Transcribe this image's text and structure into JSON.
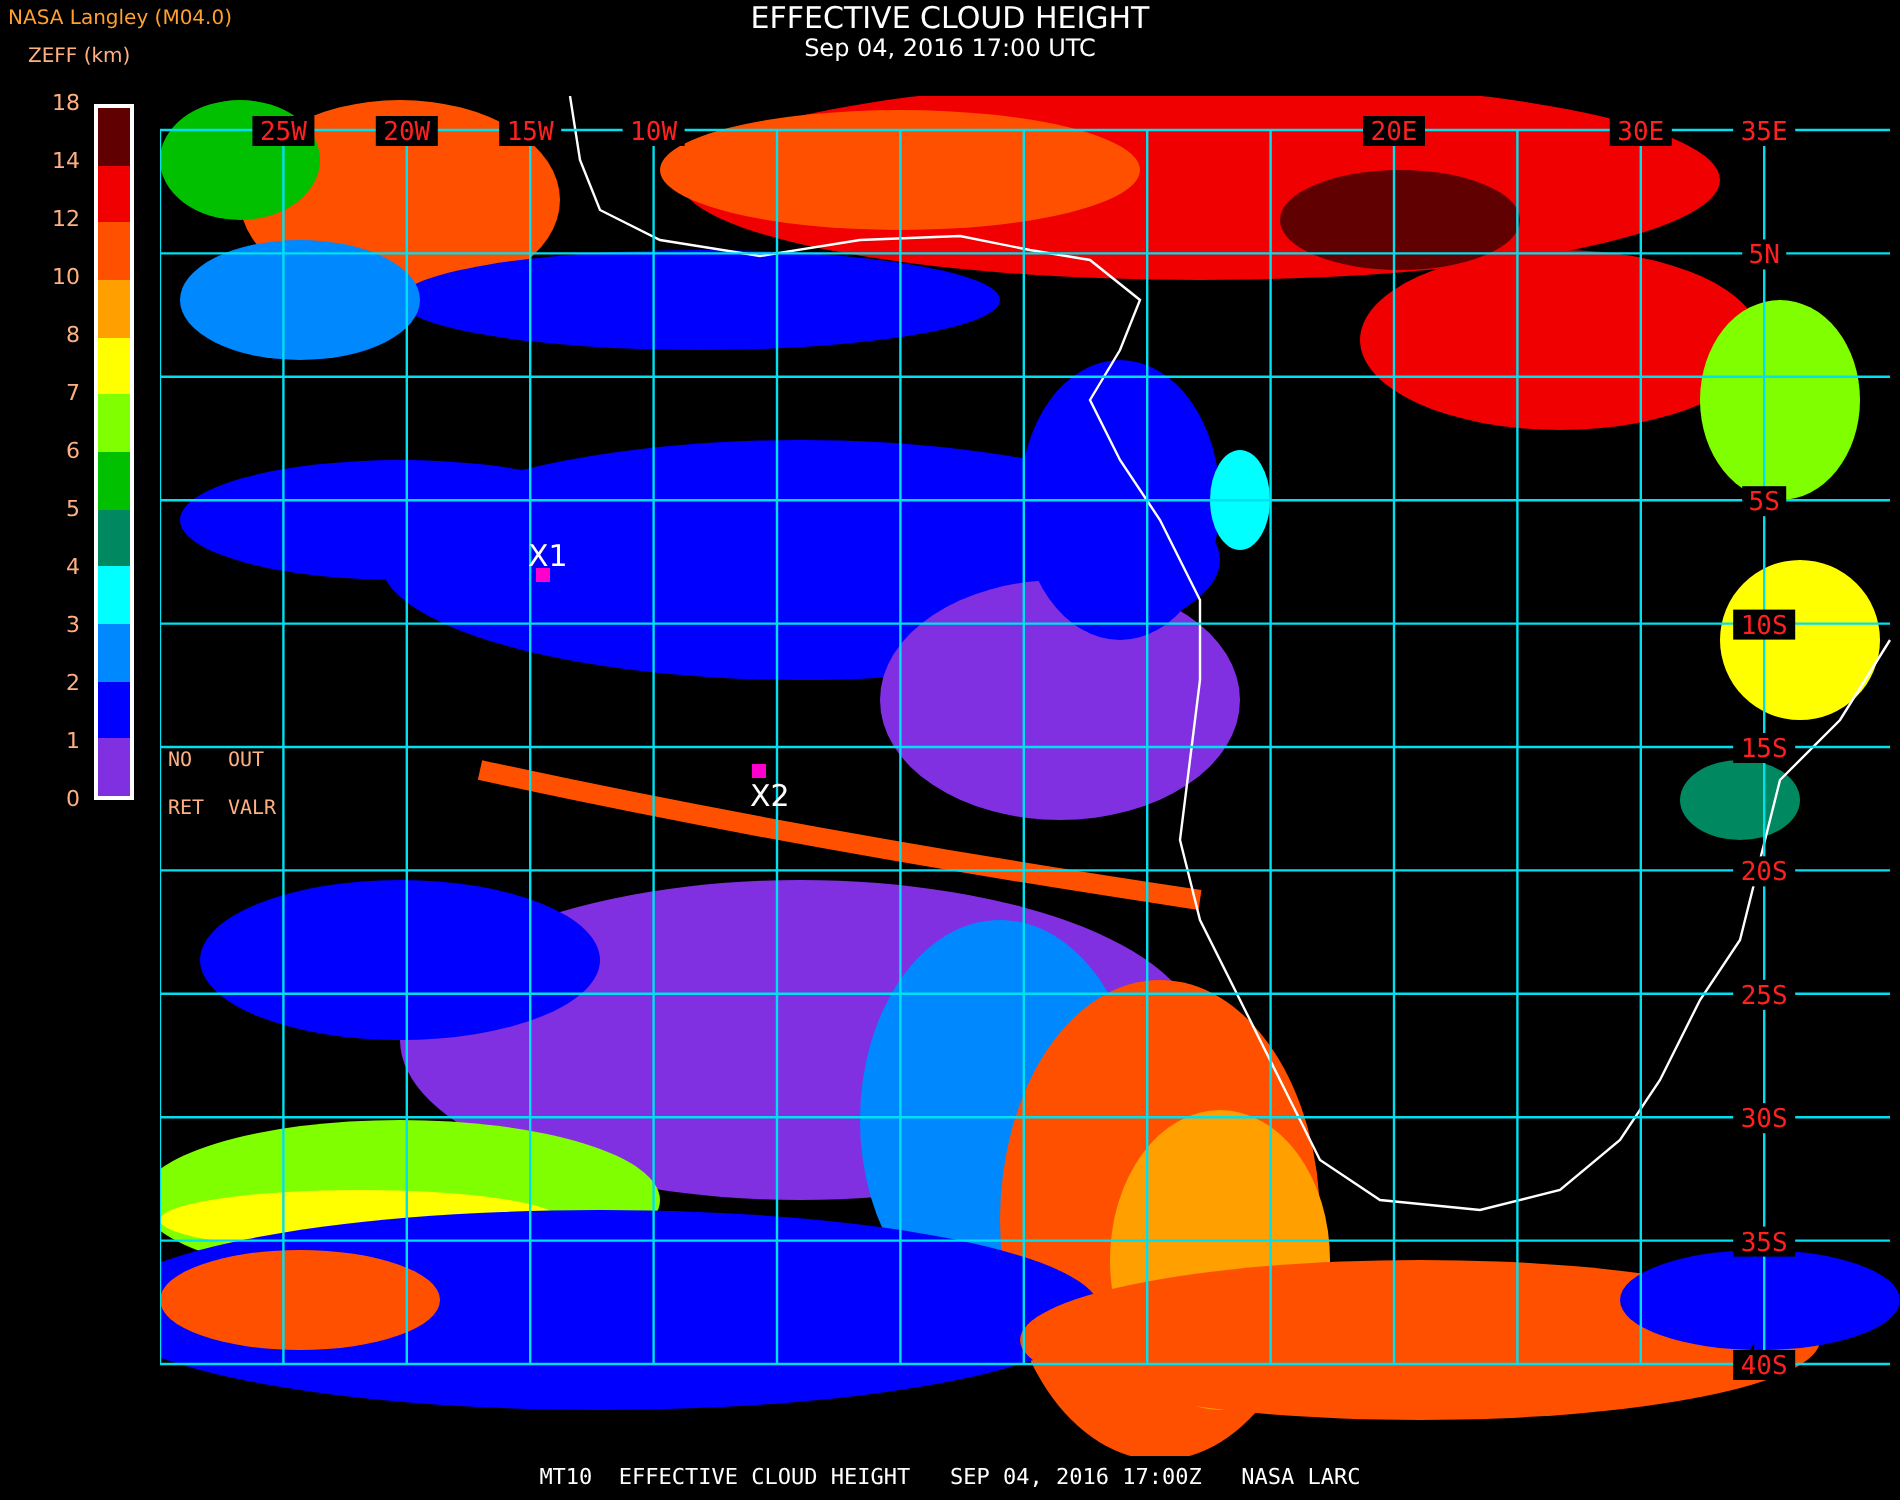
{
  "header": {
    "source": "NASA Langley (M04.0)",
    "title": "EFFECTIVE CLOUD HEIGHT",
    "timestamp": "Sep 04, 2016 17:00 UTC"
  },
  "legend": {
    "unit_label": "ZEFF (km)",
    "bands": [
      {
        "color": "#600000"
      },
      {
        "color": "#f00000"
      },
      {
        "color": "#ff5000"
      },
      {
        "color": "#ffa000"
      },
      {
        "color": "#ffff00"
      },
      {
        "color": "#80ff00"
      },
      {
        "color": "#00c000"
      },
      {
        "color": "#008860"
      },
      {
        "color": "#00ffff"
      },
      {
        "color": "#0088ff"
      },
      {
        "color": "#0000ff"
      },
      {
        "color": "#8030e0"
      }
    ],
    "ticks": [
      "18",
      "14",
      "12",
      "10",
      "8",
      "7",
      "6",
      "5",
      "4",
      "3",
      "2",
      "1",
      "0"
    ]
  },
  "map": {
    "longitude_labels": [
      "25W",
      "20W",
      "15W",
      "10W",
      "20E",
      "30E",
      "35E"
    ],
    "latitude_labels": [
      "5N",
      "5S",
      "10S",
      "15S",
      "20S",
      "25S",
      "30S",
      "35S",
      "40S"
    ],
    "notes": [
      "NO",
      "OUT",
      "RET",
      "VALR"
    ],
    "markers": [
      "X1",
      "X2"
    ]
  },
  "footer": "MT10  EFFECTIVE CLOUD HEIGHT   SEP 04, 2016 17:00Z   NASA LARC"
}
